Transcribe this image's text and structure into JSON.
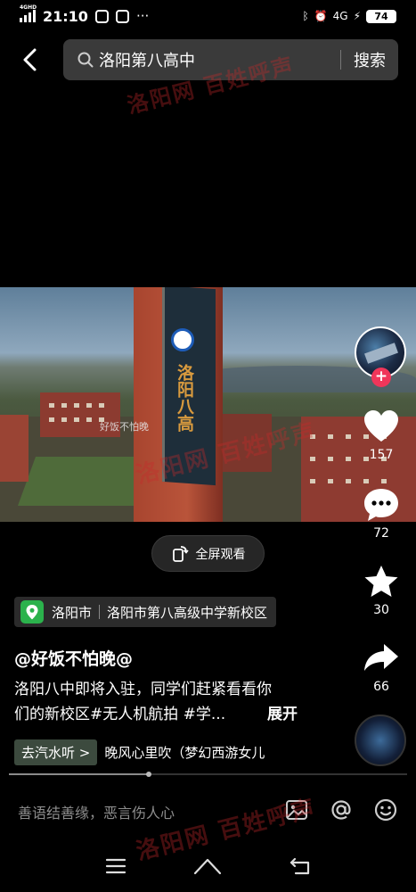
{
  "status_bar": {
    "network": "4GHD",
    "time": "21:10",
    "more": "···",
    "right_network": "4G",
    "battery": "74"
  },
  "search": {
    "query": "洛阳第八高中",
    "button": "搜索"
  },
  "video": {
    "tower_text": "洛阳八高",
    "overlay_caption": "好饭不怕晚"
  },
  "fullscreen": {
    "label": "全屏观看"
  },
  "rail": {
    "likes": "157",
    "comments": "72",
    "favorites": "30",
    "shares": "66",
    "follow_plus": "+"
  },
  "location": {
    "city": "洛阳市",
    "place": "洛阳市第八高级中学新校区"
  },
  "post": {
    "author": "@好饭不怕晚@",
    "description_line1": "洛阳八中即将入驻，同学们赶紧看看你",
    "description_line2": "们的新校区#无人机航拍 #学...",
    "expand": "展开"
  },
  "music": {
    "tag": "去汽水听 >",
    "song": "晚风心里吹（梦幻西游女儿"
  },
  "playback": {
    "progress": 0.35
  },
  "comment_bar": {
    "placeholder": "善语结善缘，恶言伤人心"
  },
  "watermark": {
    "text1": "洛阳网 百姓呼声",
    "text2": "洛阳网 百姓呼声",
    "text3": "洛阳网 百姓呼声"
  },
  "colors": {
    "like": "#ffffff",
    "follow": "#f0365a",
    "location_pin": "#2bb24c"
  }
}
